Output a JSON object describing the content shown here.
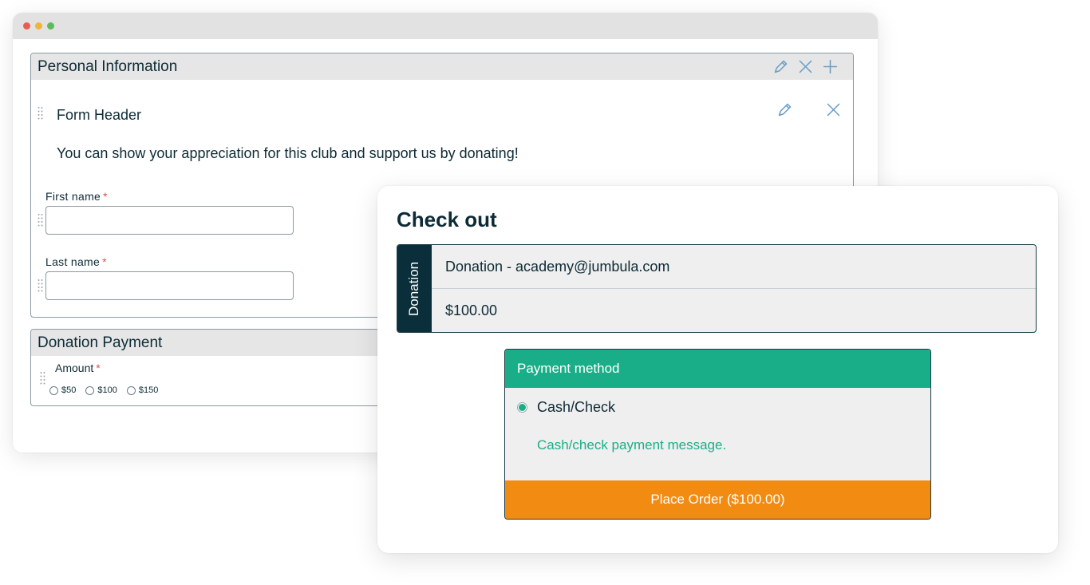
{
  "form_builder": {
    "personal_section": {
      "title": "Personal Information",
      "form_header": {
        "title": "Form Header",
        "text": "You can show your appreciation for this club and support us by donating!"
      },
      "fields": [
        {
          "label": "First name",
          "required_mark": "*",
          "value": ""
        },
        {
          "label": "Last name",
          "required_mark": "*",
          "value": ""
        }
      ]
    },
    "donation_section": {
      "title": "Donation Payment",
      "amount_label": "Amount",
      "required_mark": "*",
      "options": [
        "$50",
        "$100",
        "$150"
      ]
    }
  },
  "checkout": {
    "title": "Check out",
    "cart": {
      "side_label": "Donation",
      "item_description": "Donation - academy@jumbula.com",
      "item_price": "$100.00"
    },
    "payment": {
      "header": "Payment method",
      "selected_option": "Cash/Check",
      "message": "Cash/check payment message.",
      "place_order_label": "Place Order ($100.00)"
    }
  },
  "colors": {
    "accent_green": "#1aae88",
    "place_order_orange": "#f28b12",
    "dark_navy": "#0b2f3a",
    "icon_blue": "#6a9ec5",
    "required_red": "#d9534f"
  }
}
